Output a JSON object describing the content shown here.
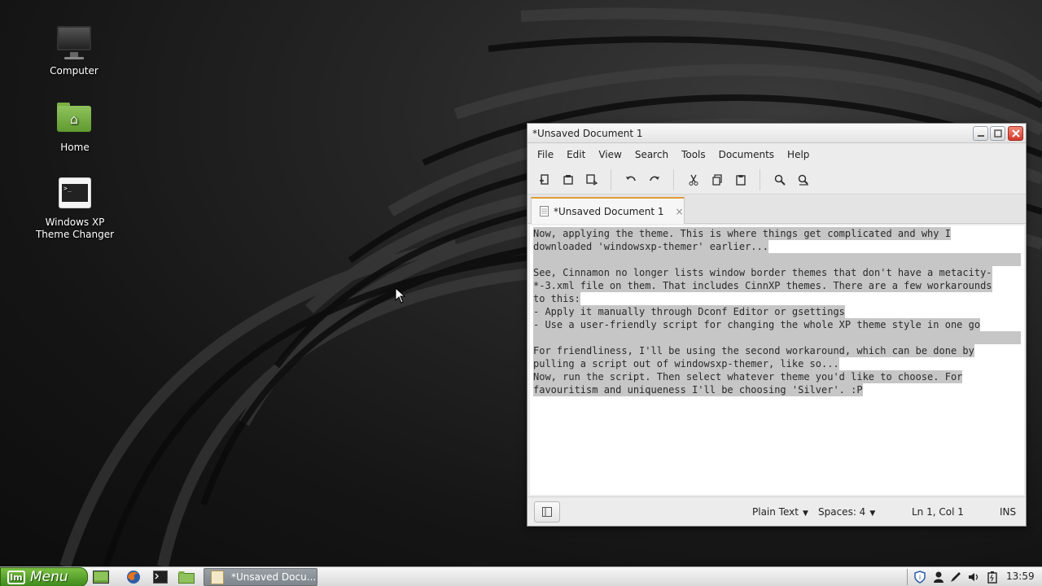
{
  "desktop": {
    "icons": [
      {
        "label": "Computer"
      },
      {
        "label": "Home"
      },
      {
        "label": "Windows XP\nTheme Changer"
      }
    ]
  },
  "window": {
    "title": "*Unsaved Document 1",
    "menu": [
      "File",
      "Edit",
      "View",
      "Search",
      "Tools",
      "Documents",
      "Help"
    ],
    "toolbar_icons": [
      "new-document-icon",
      "open-icon",
      "save-as-icon",
      "undo-icon",
      "redo-icon",
      "cut-icon",
      "copy-icon",
      "paste-icon",
      "find-icon",
      "find-replace-icon"
    ],
    "tab": {
      "label": "*Unsaved Document 1",
      "close": "×"
    },
    "editor_lines": [
      "Now, applying the theme. This is where things get complicated and why I",
      "downloaded 'windowsxp-themer' earlier...",
      "",
      "See, Cinnamon no longer lists window border themes that don't have a metacity-",
      "*-3.xml file on them. That includes CinnXP themes. There are a few workarounds",
      "to this:",
      "- Apply it manually through Dconf Editor or gsettings",
      "- Use a user-friendly script for changing the whole XP theme style in one go",
      "",
      "For friendliness, I'll be using the second workaround, which can be done by",
      "pulling a script out of windowsxp-themer, like so...",
      "Now, run the script. Then select whatever theme you'd like to choose. For",
      "favouritism and uniqueness I'll be choosing 'Silver'. :P"
    ],
    "status": {
      "language": "Plain Text",
      "spaces": "Spaces: 4",
      "position": "Ln 1, Col 1",
      "mode": "INS"
    }
  },
  "panel": {
    "menu_label": "Menu",
    "task_label": "*Unsaved Docu...",
    "clock": "13:59"
  },
  "colors": {
    "menu_green": "#5aa52e",
    "tab_accent": "#e29a3a",
    "close_red": "#d43a2a",
    "selection": "#c6c6c6"
  }
}
